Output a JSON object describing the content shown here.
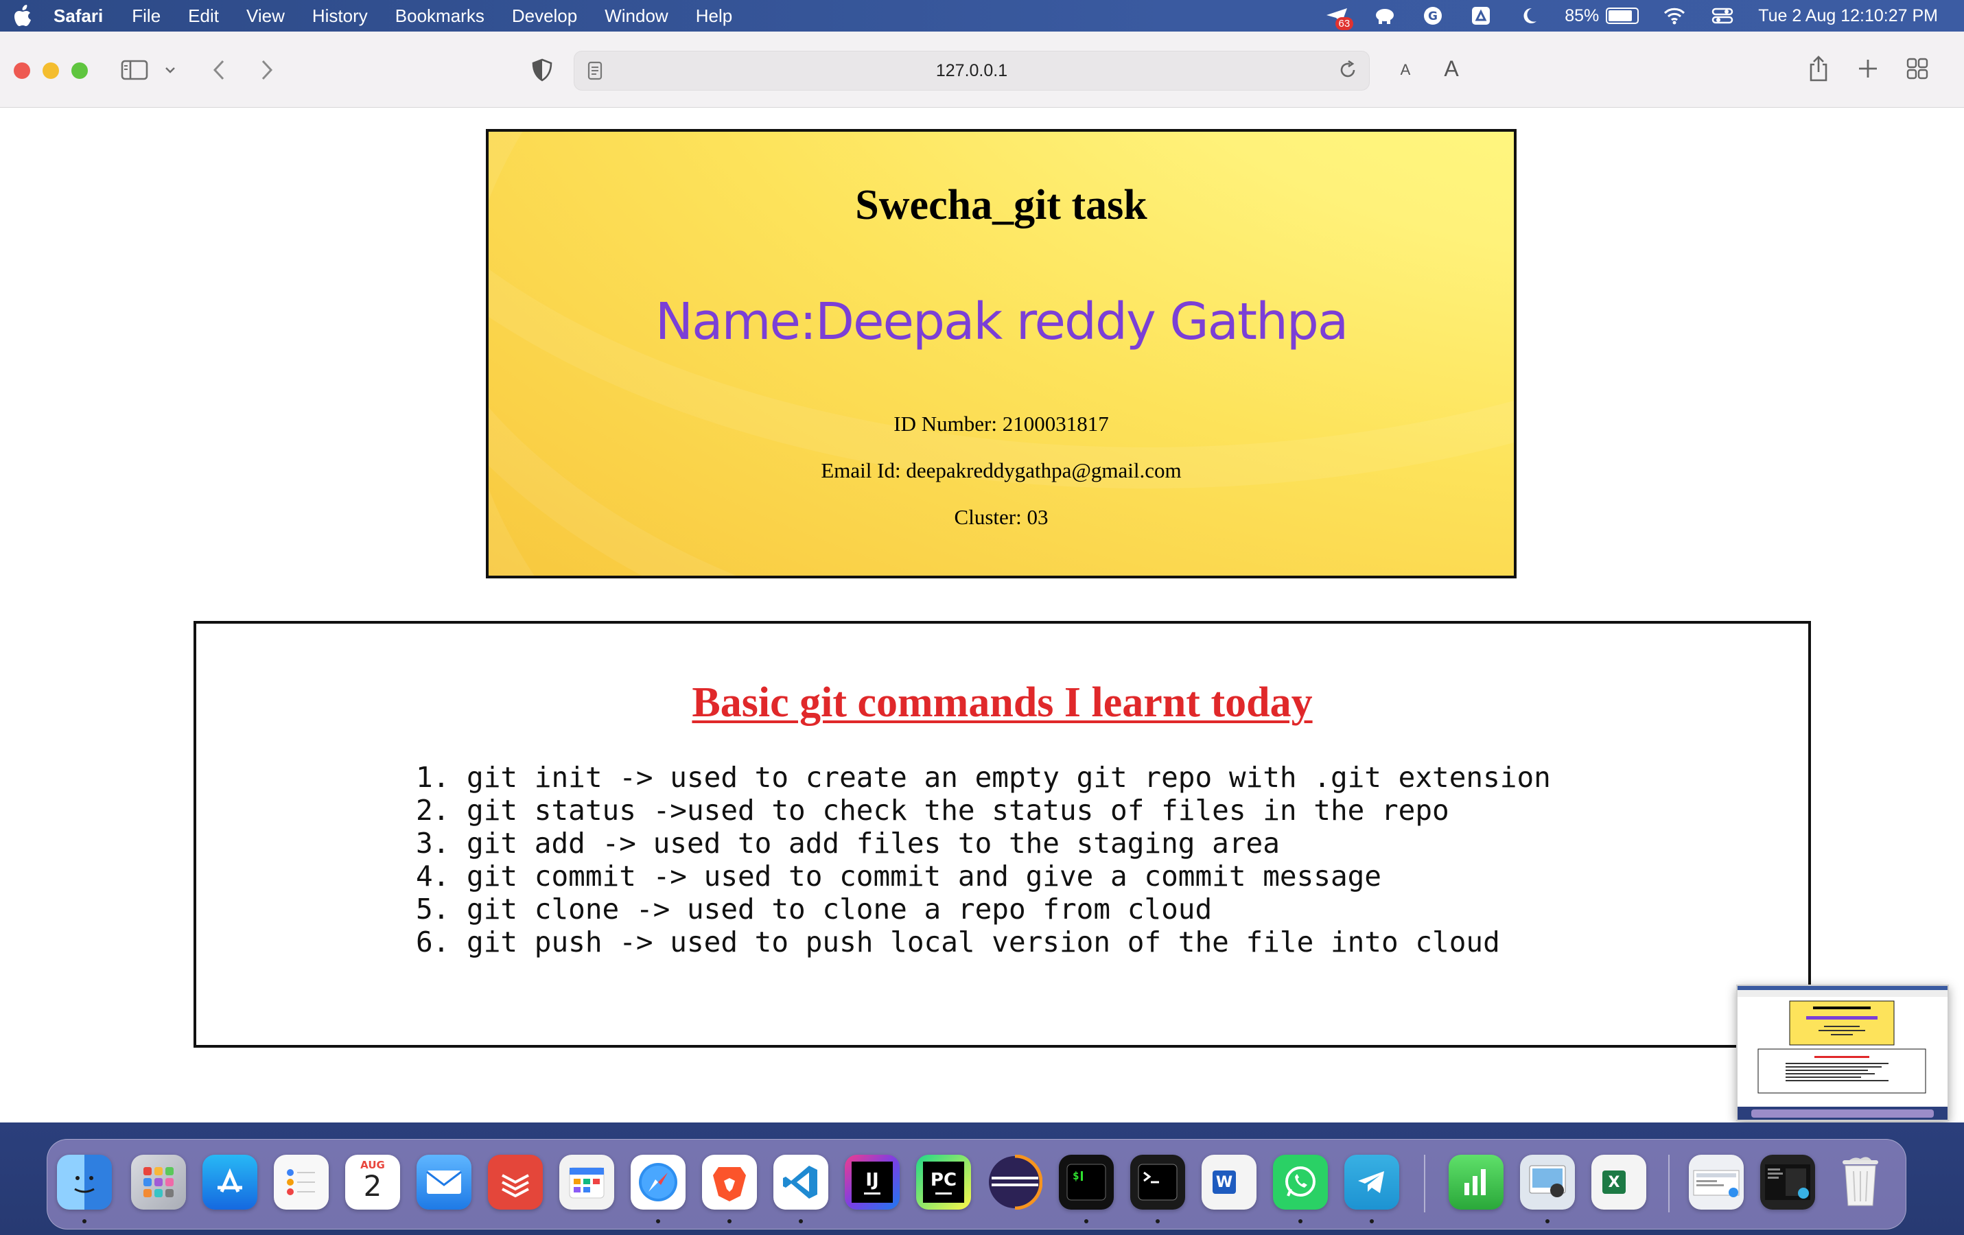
{
  "menubar": {
    "app_name": "Safari",
    "items": [
      "File",
      "Edit",
      "View",
      "History",
      "Bookmarks",
      "Develop",
      "Window",
      "Help"
    ],
    "notification_badge": "63",
    "battery_percent": "85%",
    "battery_level": 0.85,
    "datetime": "Tue 2 Aug  12:10:27 PM"
  },
  "browser": {
    "url": "127.0.0.1",
    "font_small_label": "A",
    "font_large_label": "A"
  },
  "page": {
    "title": "Swecha_git task",
    "name_line": "Name:Deepak reddy Gathpa",
    "id_line": "ID Number: 2100031817",
    "email_line": "Email Id: deepakreddygathpa@gmail.com",
    "cluster_line": "Cluster: 03",
    "commands_heading": "Basic git commands I learnt today",
    "commands": [
      "1. git init -> used to create an empty git repo with .git extension",
      "2. git status ->used to check the status of files in the repo",
      "3. git add -> used to add files to the staging area",
      "4. git commit -> used to commit and give a commit message",
      "5. git clone -> used to clone a repo from cloud",
      "6. git push -> used to push local version of the file into cloud"
    ]
  },
  "dock": {
    "calendar_month": "AUG",
    "calendar_day": "2",
    "intellij_label": "IJ",
    "pycharm_label": "PC",
    "word_label": "W",
    "excel_label": "X"
  },
  "colors": {
    "title_red": "#e0282a",
    "name_purple": "#7b3fd6",
    "card_yellow": "#fde35b"
  }
}
